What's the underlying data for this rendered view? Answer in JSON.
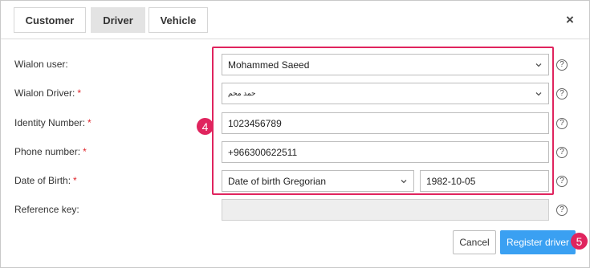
{
  "tabs": [
    {
      "label": "Customer",
      "active": false
    },
    {
      "label": "Driver",
      "active": true
    },
    {
      "label": "Vehicle",
      "active": false
    }
  ],
  "close_icon": "×",
  "form": {
    "wialon_user": {
      "label": "Wialon user:",
      "value": "Mohammed Saeed"
    },
    "wialon_driver": {
      "label": "Wialon Driver:",
      "required": "*",
      "value": "حمد محم"
    },
    "identity_number": {
      "label": "Identity Number:",
      "required": "*",
      "value": "1023456789"
    },
    "phone_number": {
      "label": "Phone number:",
      "required": "*",
      "value": "+966300622511"
    },
    "date_of_birth": {
      "label": "Date of Birth:",
      "required": "*",
      "calendar": "Date of birth Gregorian",
      "value": "1982-10-05"
    },
    "reference_key": {
      "label": "Reference key:",
      "value": ""
    }
  },
  "help_icon": "?",
  "markers": {
    "highlight": "4",
    "register": "5"
  },
  "buttons": {
    "cancel": "Cancel",
    "register": "Register driver"
  },
  "colors": {
    "accent": "#3aa0f2",
    "highlight": "#e0245e",
    "required": "#e0252b"
  }
}
